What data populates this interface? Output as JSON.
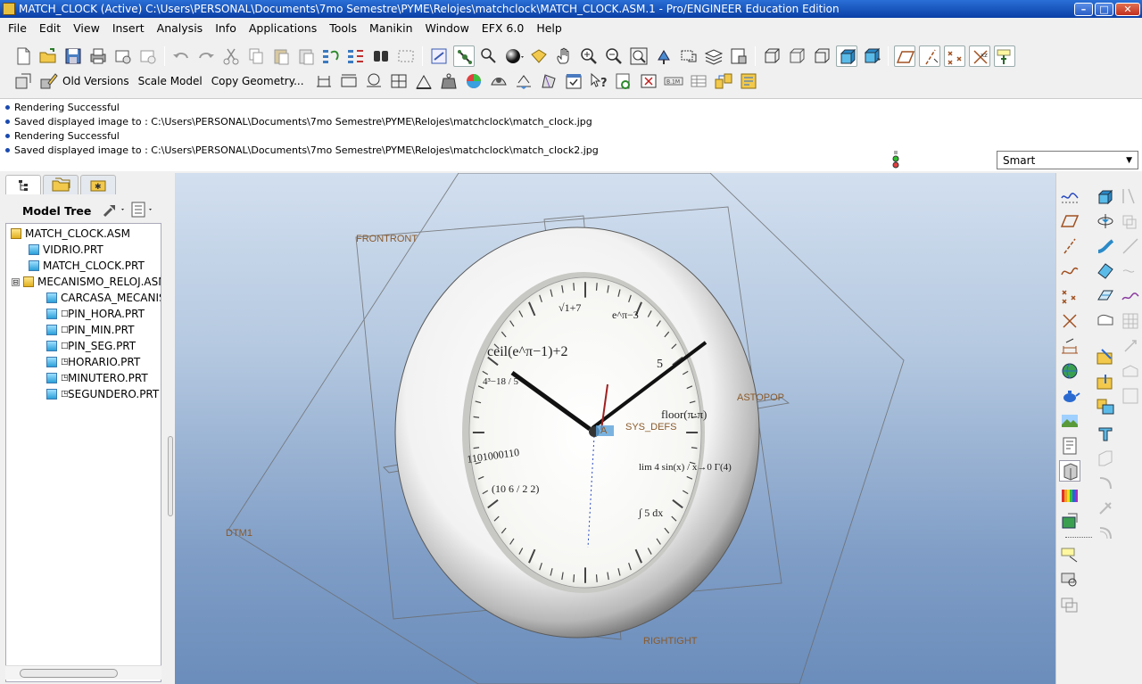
{
  "window": {
    "title": "MATCH_CLOCK (Active) C:\\Users\\PERSONAL\\Documents\\7mo Semestre\\PYME\\Relojes\\matchclock\\MATCH_CLOCK.ASM.1 - Pro/ENGINEER Education Edition",
    "minimize": "–",
    "maximize": "□",
    "close": "✕"
  },
  "menu": [
    "File",
    "Edit",
    "View",
    "Insert",
    "Analysis",
    "Info",
    "Applications",
    "Tools",
    "Manikin",
    "Window",
    "EFX 6.0",
    "Help"
  ],
  "toolbar2": {
    "old_versions": "Old Versions",
    "scale_model": "Scale Model",
    "copy_geometry": "Copy Geometry..."
  },
  "messages": [
    "Rendering Successful",
    "Saved displayed image to : C:\\Users\\PERSONAL\\Documents\\7mo Semestre\\PYME\\Relojes\\matchclock\\match_clock.jpg",
    "Rendering Successful",
    "Saved displayed image to : C:\\Users\\PERSONAL\\Documents\\7mo Semestre\\PYME\\Relojes\\matchclock\\match_clock2.jpg"
  ],
  "filter": {
    "selected": "Smart"
  },
  "model_tree": {
    "label": "Model Tree",
    "nodes": [
      {
        "name": "MATCH_CLOCK.ASM",
        "type": "asm",
        "level": 0
      },
      {
        "name": "VIDRIO.PRT",
        "type": "prt",
        "level": 1
      },
      {
        "name": "MATCH_CLOCK.PRT",
        "type": "prt",
        "level": 1
      },
      {
        "name": "MECANISMO_RELOJ.ASM",
        "type": "asm",
        "level": 1,
        "expanded": "⊟"
      },
      {
        "name": "CARCASA_MECANIS",
        "type": "prt",
        "level": 2
      },
      {
        "name": "PIN_HORA.PRT",
        "type": "prt",
        "level": 2,
        "mark": "□"
      },
      {
        "name": "PIN_MIN.PRT",
        "type": "prt",
        "level": 2,
        "mark": "□"
      },
      {
        "name": "PIN_SEG.PRT",
        "type": "prt",
        "level": 2,
        "mark": "□"
      },
      {
        "name": "HORARIO.PRT",
        "type": "prt",
        "level": 2,
        "mark": "◳"
      },
      {
        "name": "MINUTERO.PRT",
        "type": "prt",
        "level": 2,
        "mark": "◳"
      },
      {
        "name": "SEGUNDERO.PRT",
        "type": "prt",
        "level": 2,
        "mark": "◳"
      }
    ]
  },
  "viewport": {
    "datum_labels": {
      "front": "FRONTRONT",
      "top": "ASTOPOP",
      "dtm1": "DTM1",
      "right": "RIGHTIGHT",
      "csys": "SYS_DEFS",
      "axis": "A"
    },
    "clock_face_formulas": [
      "ceil(e^π−1)+2",
      "√1+7",
      "e^π−3",
      "4³−18 / 5",
      "5",
      "floor(π·π)",
      "1101000110",
      "lim 4 sin(x) / x→0 Γ(4)",
      "(10 6 / 2 2)",
      "∫ 5 dx"
    ]
  },
  "colors": {
    "accent": "#0a3fa6",
    "background_top": "#d2dfef",
    "background_bottom": "#6b8dbb",
    "datum": "#8a5a2a"
  }
}
